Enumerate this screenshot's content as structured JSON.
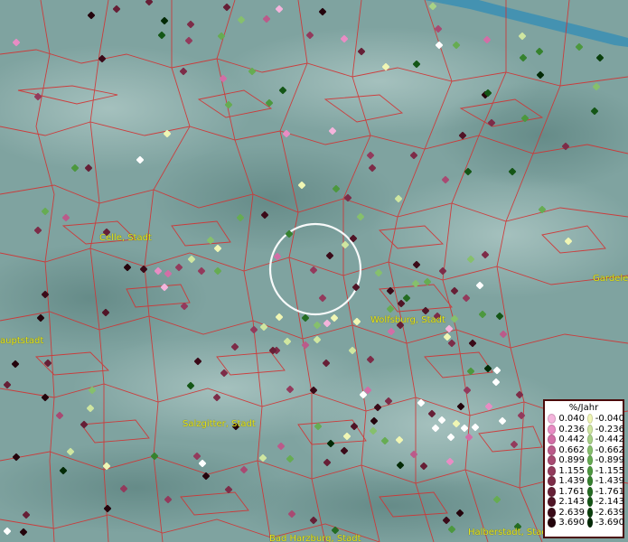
{
  "map": {
    "background": "#7fa3a0",
    "border_color": "#d23232",
    "highlight_circle_color": "#ffffff"
  },
  "cities": [
    {
      "id": "celle",
      "label": "Celle, Stadt"
    },
    {
      "id": "wolfsburg",
      "label": "Wolfsburg, Stadt"
    },
    {
      "id": "salzgitter",
      "label": "Salzgitter, Stadt"
    },
    {
      "id": "hauptstadt",
      "label": "auptstadt"
    },
    {
      "id": "gardelegen",
      "label": "Gardele"
    },
    {
      "id": "bad-harzburg",
      "label": "Bad Harzburg, Stadt"
    },
    {
      "id": "halberstadt",
      "label": "Halberstadt, Stadt"
    }
  ],
  "legend": {
    "title": "%/Jahr",
    "positive": [
      {
        "label": "0.040",
        "color": "#f4b4dc"
      },
      {
        "label": "0.236",
        "color": "#e88cc4"
      },
      {
        "label": "0.442",
        "color": "#d26ea6"
      },
      {
        "label": "0.662",
        "color": "#bb5a8a"
      },
      {
        "label": "0.899",
        "color": "#a84a72"
      },
      {
        "label": "1.155",
        "color": "#933a5c"
      },
      {
        "label": "1.439",
        "color": "#7d2c48"
      },
      {
        "label": "1.761",
        "color": "#661f36"
      },
      {
        "label": "2.143",
        "color": "#501426"
      },
      {
        "label": "2.639",
        "color": "#3a0a18"
      },
      {
        "label": "3.690",
        "color": "#24040c"
      }
    ],
    "negative": [
      {
        "label": "-0.040",
        "color": "#f0f6b4"
      },
      {
        "label": "-0.236",
        "color": "#cfe6a0"
      },
      {
        "label": "-0.442",
        "color": "#a8d286"
      },
      {
        "label": "-0.662",
        "color": "#86c06c"
      },
      {
        "label": "-0.899",
        "color": "#66ac52"
      },
      {
        "label": "-1.155",
        "color": "#4c983e"
      },
      {
        "label": "-1.439",
        "color": "#36822e"
      },
      {
        "label": "-1.761",
        "color": "#246c22"
      },
      {
        "label": "-2.143",
        "color": "#145616"
      },
      {
        "label": "-2.639",
        "color": "#0a400c"
      },
      {
        "label": "-3.690",
        "color": "#032a06"
      }
    ]
  }
}
